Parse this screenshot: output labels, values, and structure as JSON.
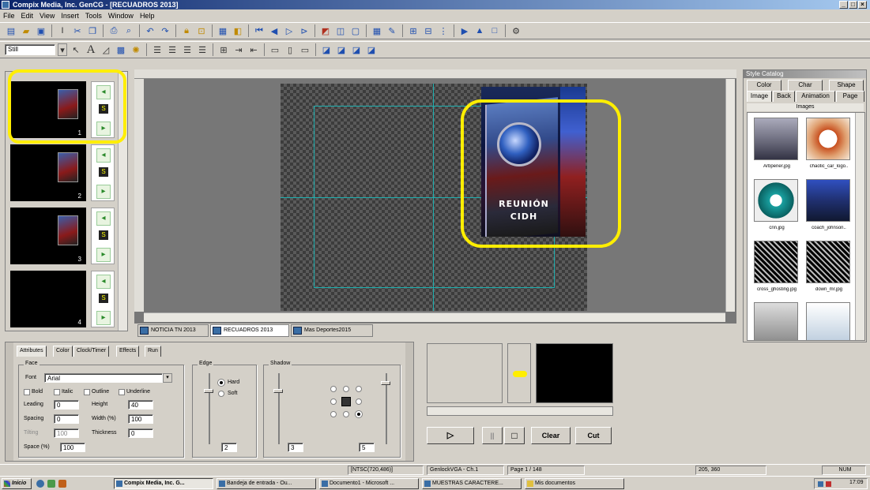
{
  "window": {
    "title": "Compix Media, Inc. GenCG - [RECUADROS 2013]"
  },
  "menu": [
    "File",
    "Edit",
    "View",
    "Insert",
    "Tools",
    "Window",
    "Help"
  ],
  "toolbar2": {
    "size_value": "Still"
  },
  "thumbnails": [
    {
      "num": "1"
    },
    {
      "num": "2"
    },
    {
      "num": "3"
    },
    {
      "num": "4"
    }
  ],
  "canvas": {
    "graphic_line1": "REUNIÓN",
    "graphic_line2": "CIDH"
  },
  "doc_tabs": [
    "NOTICIA TN 2013",
    "RECUADROS 2013",
    "Mas Deportes2015"
  ],
  "catalog": {
    "title": "Style Catalog",
    "tabs_row1": [
      "Color",
      "Char",
      "Shape"
    ],
    "tabs_row2": [
      "Image",
      "Back",
      "Animation",
      "Page"
    ],
    "group_label": "Images",
    "items": [
      "Arbpener.jpg",
      "chaotic_car_logo..",
      "cnn.jpg",
      "coach_johnson..",
      "cross_ghosting.jpg",
      "down_mr.jpg"
    ]
  },
  "attributes": {
    "tabs": [
      "Attributes",
      "Color",
      "Clock/Timer",
      "Effects",
      "Run"
    ],
    "face_legend": "Face",
    "font_label": "Font",
    "font_value": "Arial",
    "bold": "Bold",
    "italic": "Italic",
    "outline": "Outline",
    "underline": "Underline",
    "leading_label": "Leading",
    "leading_value": "0",
    "height_label": "Height",
    "height_value": "40",
    "spacing_label": "Spacing",
    "spacing_value": "0",
    "width_label": "Width (%)",
    "width_value": "100",
    "tilting_label": "Tilting",
    "tilting_value": "100",
    "thickness_label": "Thickness",
    "thickness_value": "0",
    "space_label": "Space (%)",
    "space_value": "100",
    "edge_legend": "Edge",
    "hard": "Hard",
    "soft": "Soft",
    "edge_value": "2",
    "shadow_legend": "Shadow",
    "shadow_value1": "3",
    "shadow_value2": "5"
  },
  "playback": {
    "clear": "Clear",
    "cut": "Cut"
  },
  "statusbar": {
    "format": "[NTSC(720,486)]",
    "genlock": "GenlockVGA - Ch.1",
    "page": "Page 1 / 148",
    "coords": "205, 360",
    "num": "NUM"
  },
  "taskbar": {
    "start": "Inicio",
    "tasks": [
      "Compix Media, Inc. G...",
      "Bandeja de entrada - Ou...",
      "Documento1 - Microsoft ...",
      "MUESTRAS CARACTERE...",
      "Mis documentos"
    ],
    "clock": "17:09"
  }
}
